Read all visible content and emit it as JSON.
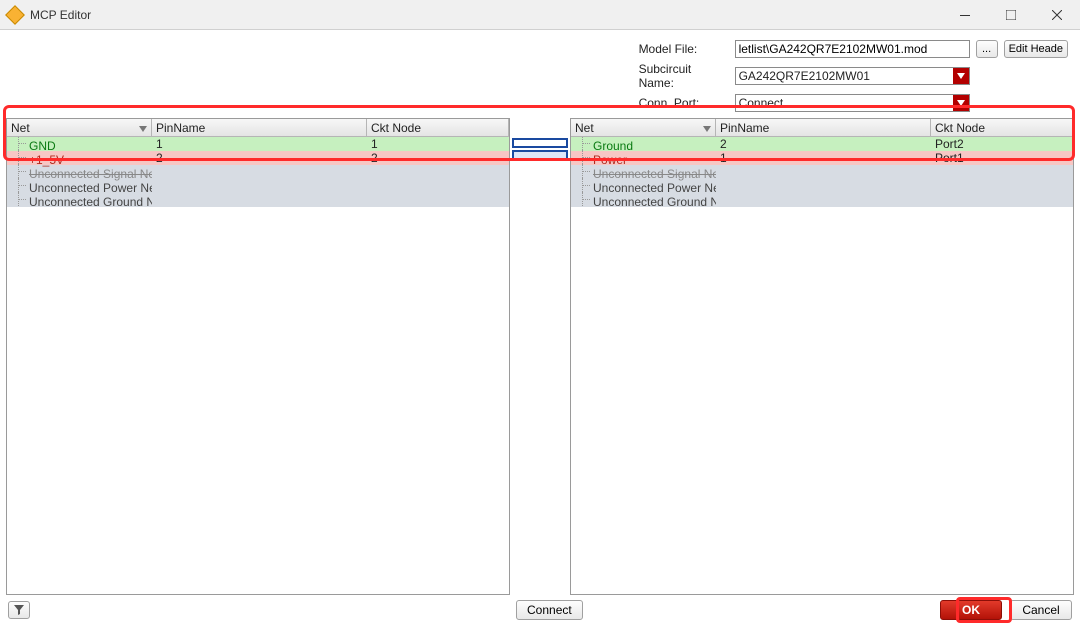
{
  "window": {
    "title": "MCP Editor"
  },
  "form": {
    "model_file_label": "Model File:",
    "model_file_value": "letlist\\GA242QR7E2102MW01.mod",
    "browse_label": "...",
    "edit_header_label": "Edit Heade",
    "subcircuit_label": "Subcircuit Name:",
    "subcircuit_value": "GA242QR7E2102MW01",
    "conn_port_label": "Conn. Port:",
    "conn_port_value": "Connect"
  },
  "columns": {
    "net": "Net",
    "pin": "PinName",
    "ckt": "Ckt Node"
  },
  "left_rows": [
    {
      "type": "green",
      "net": "GND",
      "pin": "1",
      "ckt": "1"
    },
    {
      "type": "pink",
      "net": "+1_5V",
      "pin": "2",
      "ckt": "2"
    },
    {
      "type": "gray_struck",
      "net": "Unconnected Signal Net(s)"
    },
    {
      "type": "gray",
      "net": "Unconnected Power Net..."
    },
    {
      "type": "gray",
      "net": "Unconnected Ground N..."
    }
  ],
  "right_rows": [
    {
      "type": "green",
      "net": "Ground",
      "pin": "2",
      "ckt": "Port2"
    },
    {
      "type": "pink",
      "net": "Power",
      "pin": "1",
      "ckt": "Port1"
    },
    {
      "type": "gray_struck",
      "net": "Unconnected Signal Net(s)"
    },
    {
      "type": "gray",
      "net": "Unconnected Power Net..."
    },
    {
      "type": "gray",
      "net": "Unconnected Ground N..."
    }
  ],
  "buttons": {
    "connect": "Connect",
    "ok": "OK",
    "cancel": "Cancel"
  }
}
